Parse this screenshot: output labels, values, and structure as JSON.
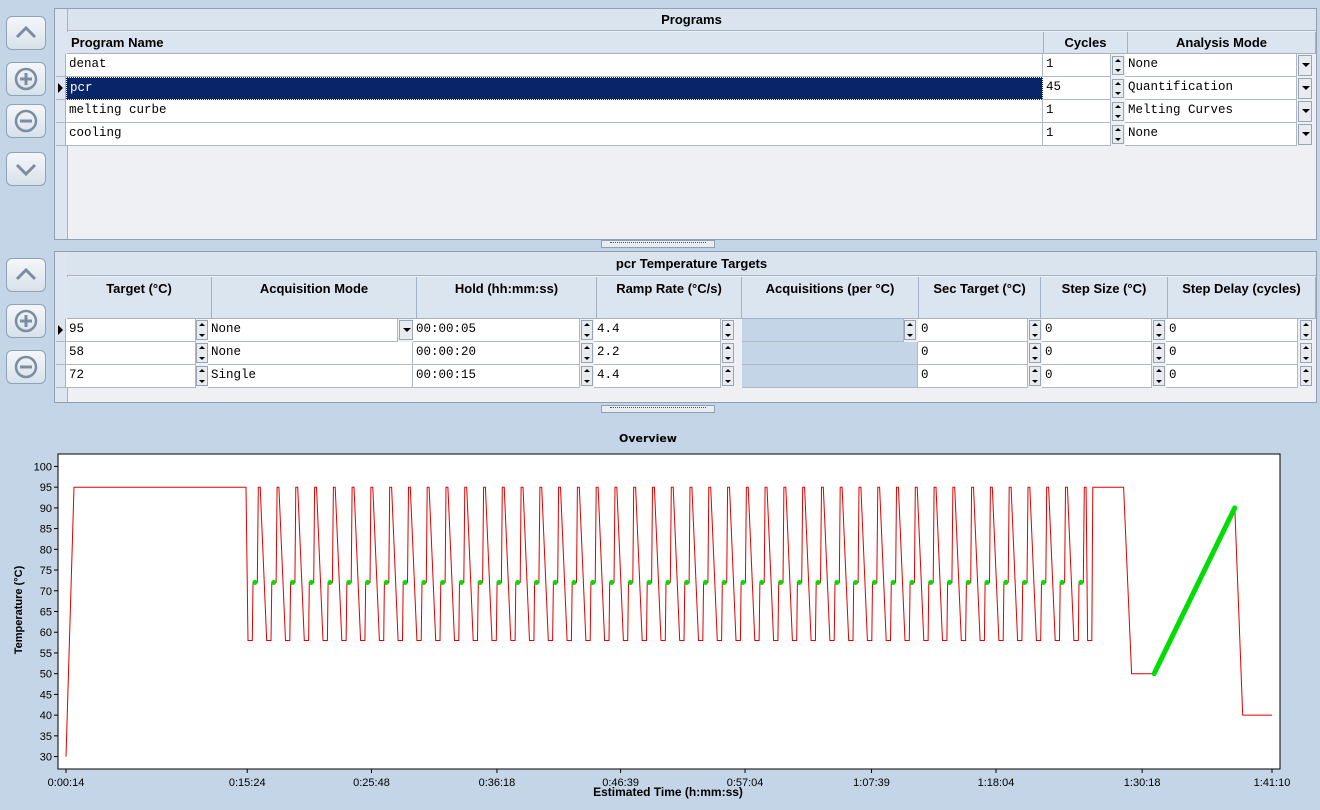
{
  "programs": {
    "title": "Programs",
    "columns": {
      "name": "Program Name",
      "cycles": "Cycles",
      "mode": "Analysis Mode"
    },
    "rows": [
      {
        "name": "denat",
        "cycles": "1",
        "mode": "None"
      },
      {
        "name": "pcr",
        "cycles": "45",
        "mode": "Quantification"
      },
      {
        "name": "melting curbe",
        "cycles": "1",
        "mode": "Melting Curves"
      },
      {
        "name": "cooling",
        "cycles": "1",
        "mode": "None"
      }
    ],
    "selected_index": 1
  },
  "targets": {
    "title": "pcr Temperature Targets",
    "columns": [
      "Target (°C)",
      "Acquisition Mode",
      "Hold (hh:mm:ss)",
      "Ramp Rate (°C/s)",
      "Acquisitions (per °C)",
      "Sec Target (°C)",
      "Step Size (°C)",
      "Step Delay (cycles)"
    ],
    "rows": [
      {
        "target": "95",
        "mode": "None",
        "hold": "00:00:05",
        "ramp": "4.4",
        "acq": "",
        "sec": "0",
        "step": "0",
        "delay": "0"
      },
      {
        "target": "58",
        "mode": "None",
        "hold": "00:00:20",
        "ramp": "2.2",
        "acq": "",
        "sec": "0",
        "step": "0",
        "delay": "0"
      },
      {
        "target": "72",
        "mode": "Single",
        "hold": "00:00:15",
        "ramp": "4.4",
        "acq": "",
        "sec": "0",
        "step": "0",
        "delay": "0"
      }
    ]
  },
  "side_buttons": [
    "chevron-up-icon",
    "plus-circle-icon",
    "minus-circle-icon",
    "chevron-down-icon"
  ],
  "chart_data": {
    "type": "line",
    "title": "Overview",
    "xlabel": "Estimated Time (h:mm:ss)",
    "ylabel": "Temperature (°C)",
    "ylim": [
      27,
      103
    ],
    "yticks": [
      30,
      35,
      40,
      45,
      50,
      55,
      60,
      65,
      70,
      75,
      80,
      85,
      90,
      95,
      100
    ],
    "xlim_seconds": [
      14,
      6070
    ],
    "xticks": [
      "0:00:14",
      "0:15:24",
      "0:25:48",
      "0:36:18",
      "0:46:39",
      "0:57:04",
      "1:07:39",
      "1:18:04",
      "1:30:18",
      "1:41:10"
    ],
    "xticks_seconds": [
      14,
      924,
      1548,
      2178,
      2799,
      3424,
      4059,
      4684,
      5418,
      6070
    ],
    "series": [
      {
        "color": "#e00000",
        "profile": "temperature"
      },
      {
        "color": "#00dd00",
        "profile": "acquisitions"
      }
    ],
    "segments": {
      "denat": {
        "start_temp": 30,
        "hold_temp": 95,
        "hold_end_seconds": 918
      },
      "pcr": {
        "cycles": 45,
        "temps": [
          95,
          58,
          72
        ],
        "end_seconds": 5165
      },
      "melting": {
        "from": 50,
        "to": 90,
        "ramp_start_seconds": 5478,
        "ramp_end_seconds": 5883
      },
      "cooling": {
        "temp": 40,
        "end_seconds": 6070
      }
    },
    "grid": false,
    "colors": {
      "temperature": "#e00000",
      "acquisition": "#00dd00"
    }
  }
}
